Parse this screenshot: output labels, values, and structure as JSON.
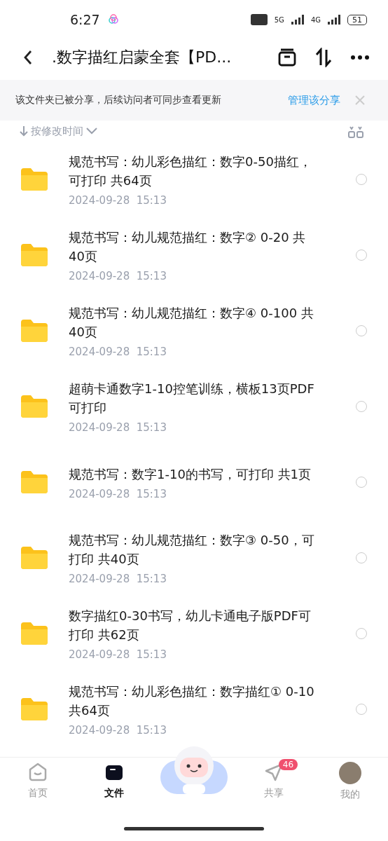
{
  "status_bar": {
    "time": "6:27",
    "network_1": "5G",
    "network_2": "4G",
    "battery": "51"
  },
  "header": {
    "title": ".数字描红启蒙全套【PD..."
  },
  "share_banner": {
    "text": "该文件夹已被分享，后续访问者可同步查看更新",
    "action": "管理该分享"
  },
  "sort": {
    "label": "按修改时间"
  },
  "files": [
    {
      "name": "规范书写：幼儿彩色描红：数字0-50描红，可打印 共64页",
      "date": "2024-09-28  15:13",
      "selected": false
    },
    {
      "name": "规范书写：幼儿规范描红：数字② 0-20 共40页",
      "date": "2024-09-28  15:13",
      "selected": false
    },
    {
      "name": "规范书写：幼儿规范描红：数字④ 0-100 共40页",
      "date": "2024-09-28  15:13",
      "selected": false
    },
    {
      "name": "超萌卡通数字1-10控笔训练，横板13页PDF可打印",
      "date": "2024-09-28  15:13",
      "selected": false
    },
    {
      "name": "规范书写：数字1-10的书写，可打印 共1页",
      "date": "2024-09-28  15:13",
      "selected": false
    },
    {
      "name": "规范书写：幼儿规范描红：数字③ 0-50，可打印 共40页",
      "date": "2024-09-28  15:13",
      "selected": false
    },
    {
      "name": "数字描红0-30书写，幼儿卡通电子版PDF可打印 共62页",
      "date": "2024-09-28  15:13",
      "selected": false
    },
    {
      "name": "规范书写：幼儿彩色描红：数字描红① 0-10 共64页",
      "date": "2024-09-28  15:13",
      "selected": false
    }
  ],
  "tab_bar": [
    {
      "kind": "home",
      "label": "首页",
      "selected": false
    },
    {
      "kind": "files",
      "label": "文件",
      "selected": true
    },
    {
      "kind": "mascot",
      "selected": false
    },
    {
      "kind": "share",
      "label": "共享",
      "badge": "46",
      "selected": false
    },
    {
      "kind": "me",
      "label": "我的",
      "selected": false
    }
  ]
}
